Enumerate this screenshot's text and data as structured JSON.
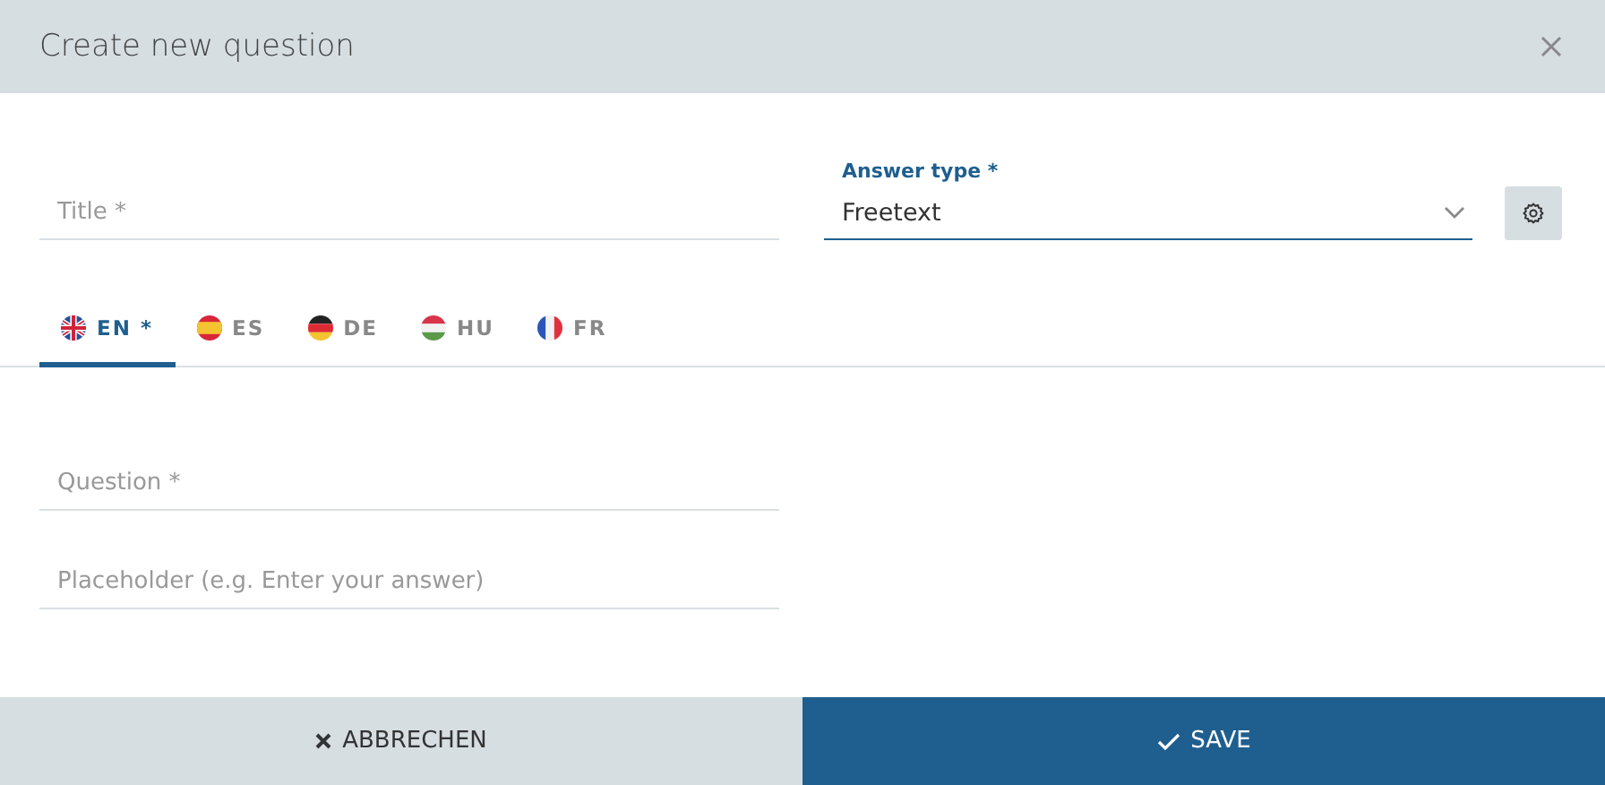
{
  "dialog": {
    "title": "Create new question"
  },
  "title_field": {
    "placeholder": "Title *"
  },
  "answer_type": {
    "label": "Answer type *",
    "value": "Freetext"
  },
  "language_tabs": [
    {
      "label": "EN *",
      "kind": "gb",
      "selected": true
    },
    {
      "label": "ES",
      "kind": "es",
      "selected": false
    },
    {
      "label": "DE",
      "kind": "de",
      "selected": false
    },
    {
      "label": "HU",
      "kind": "hu",
      "selected": false
    },
    {
      "label": "FR",
      "kind": "fr",
      "selected": false
    }
  ],
  "question_field": {
    "placeholder": "Question *"
  },
  "placeholder_field": {
    "placeholder": "Placeholder (e.g. Enter your answer)"
  },
  "buttons": [
    {
      "label": "ABBRECHEN",
      "kind": "cancel"
    },
    {
      "label": "SAVE",
      "kind": "save"
    }
  ]
}
